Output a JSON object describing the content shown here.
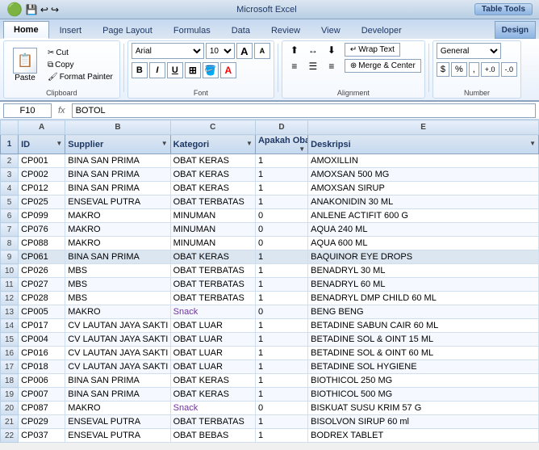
{
  "titleBar": {
    "appName": "Microsoft Excel",
    "fileName": "Table Tools",
    "badge": "Table Tools"
  },
  "tabs": [
    {
      "label": "Home",
      "active": true
    },
    {
      "label": "Insert",
      "active": false
    },
    {
      "label": "Page Layout",
      "active": false
    },
    {
      "label": "Formulas",
      "active": false
    },
    {
      "label": "Data",
      "active": false
    },
    {
      "label": "Review",
      "active": false
    },
    {
      "label": "View",
      "active": false
    },
    {
      "label": "Developer",
      "active": false
    },
    {
      "label": "Design",
      "active": false,
      "special": true
    }
  ],
  "ribbon": {
    "groups": {
      "clipboard": "Clipboard",
      "font": "Font",
      "alignment": "Alignment",
      "number": "Number"
    },
    "paste": "Paste",
    "cut": "Cut",
    "copy": "Copy",
    "formatPainter": "Format Painter",
    "fontName": "Arial",
    "fontSize": "10",
    "bold": "B",
    "italic": "I",
    "underline": "U",
    "wrapText": "Wrap Text",
    "mergeCenter": "Merge & Center",
    "numberFormat": "General"
  },
  "formulaBar": {
    "cellRef": "F10",
    "fx": "fx",
    "value": "BOTOL"
  },
  "columns": [
    {
      "header": "",
      "class": "col-a"
    },
    {
      "header": "ID",
      "class": "col-b"
    },
    {
      "header": "Supplier",
      "class": "col-c"
    },
    {
      "header": "Kategori",
      "class": "col-d"
    },
    {
      "header": "Apakah Obat",
      "class": "col-e"
    },
    {
      "header": "Deskripsi",
      "class": "col-f"
    }
  ],
  "columnLetters": [
    "",
    "A",
    "B",
    "C",
    "D",
    "E"
  ],
  "rows": [
    {
      "num": "2",
      "id": "CP001",
      "supplier": "BINA SAN PRIMA",
      "kategori": "OBAT KERAS",
      "obat": "1",
      "deskripsi": "AMOXILLIN",
      "snack": false,
      "selected": false
    },
    {
      "num": "3",
      "id": "CP002",
      "supplier": "BINA SAN PRIMA",
      "kategori": "OBAT KERAS",
      "obat": "1",
      "deskripsi": "AMOXSAN 500 MG",
      "snack": false,
      "selected": false
    },
    {
      "num": "4",
      "id": "CP012",
      "supplier": "BINA SAN PRIMA",
      "kategori": "OBAT KERAS",
      "obat": "1",
      "deskripsi": "AMOXSAN SIRUP",
      "snack": false,
      "selected": false
    },
    {
      "num": "5",
      "id": "CP025",
      "supplier": "ENSEVAL PUTRA",
      "kategori": "OBAT TERBATAS",
      "obat": "1",
      "deskripsi": "ANAKONIDIN 30 ML",
      "snack": false,
      "selected": false
    },
    {
      "num": "6",
      "id": "CP099",
      "supplier": "MAKRO",
      "kategori": "MINUMAN",
      "obat": "0",
      "deskripsi": "ANLENE ACTIFIT 600 G",
      "snack": false,
      "selected": false
    },
    {
      "num": "7",
      "id": "CP076",
      "supplier": "MAKRO",
      "kategori": "MINUMAN",
      "obat": "0",
      "deskripsi": "AQUA 240 ML",
      "snack": false,
      "selected": false
    },
    {
      "num": "8",
      "id": "CP088",
      "supplier": "MAKRO",
      "kategori": "MINUMAN",
      "obat": "0",
      "deskripsi": "AQUA 600 ML",
      "snack": false,
      "selected": false
    },
    {
      "num": "9",
      "id": "CP061",
      "supplier": "BINA SAN PRIMA",
      "kategori": "OBAT KERAS",
      "obat": "1",
      "deskripsi": "BAQUINOR EYE DROPS",
      "snack": false,
      "selected": true
    },
    {
      "num": "10",
      "id": "CP026",
      "supplier": "MBS",
      "kategori": "OBAT TERBATAS",
      "obat": "1",
      "deskripsi": "BENADRYL 30 ML",
      "snack": false,
      "selected": false
    },
    {
      "num": "11",
      "id": "CP027",
      "supplier": "MBS",
      "kategori": "OBAT TERBATAS",
      "obat": "1",
      "deskripsi": "BENADRYL 60 ML",
      "snack": false,
      "selected": false
    },
    {
      "num": "12",
      "id": "CP028",
      "supplier": "MBS",
      "kategori": "OBAT TERBATAS",
      "obat": "1",
      "deskripsi": "BENADRYL DMP CHILD 60 ML",
      "snack": false,
      "selected": false
    },
    {
      "num": "13",
      "id": "CP005",
      "supplier": "MAKRO",
      "kategori": "Snack",
      "obat": "0",
      "deskripsi": "BENG BENG",
      "snack": true,
      "selected": false
    },
    {
      "num": "14",
      "id": "CP017",
      "supplier": "CV LAUTAN JAYA SAKTI",
      "kategori": "OBAT LUAR",
      "obat": "1",
      "deskripsi": "BETADINE SABUN CAIR 60 ML",
      "snack": false,
      "selected": false
    },
    {
      "num": "15",
      "id": "CP004",
      "supplier": "CV LAUTAN JAYA SAKTI",
      "kategori": "OBAT LUAR",
      "obat": "1",
      "deskripsi": "BETADINE SOL & OINT 15 ML",
      "snack": false,
      "selected": false
    },
    {
      "num": "16",
      "id": "CP016",
      "supplier": "CV LAUTAN JAYA SAKTI",
      "kategori": "OBAT LUAR",
      "obat": "1",
      "deskripsi": "BETADINE SOL & OINT 60 ML",
      "snack": false,
      "selected": false
    },
    {
      "num": "17",
      "id": "CP018",
      "supplier": "CV LAUTAN JAYA SAKTI",
      "kategori": "OBAT LUAR",
      "obat": "1",
      "deskripsi": "BETADINE SOL HYGIENE",
      "snack": false,
      "selected": false
    },
    {
      "num": "18",
      "id": "CP006",
      "supplier": "BINA SAN PRIMA",
      "kategori": "OBAT KERAS",
      "obat": "1",
      "deskripsi": "BIOTHICOL 250 MG",
      "snack": false,
      "selected": false
    },
    {
      "num": "19",
      "id": "CP007",
      "supplier": "BINA SAN PRIMA",
      "kategori": "OBAT KERAS",
      "obat": "1",
      "deskripsi": "BIOTHICOL 500 MG",
      "snack": false,
      "selected": false
    },
    {
      "num": "20",
      "id": "CP087",
      "supplier": "MAKRO",
      "kategori": "Snack",
      "obat": "0",
      "deskripsi": "BISKUAT SUSU KRIM 57 G",
      "snack": true,
      "selected": false
    },
    {
      "num": "21",
      "id": "CP029",
      "supplier": "ENSEVAL PUTRA",
      "kategori": "OBAT TERBATAS",
      "obat": "1",
      "deskripsi": "BISOLVON SIRUP 60 ml",
      "snack": false,
      "selected": false
    },
    {
      "num": "22",
      "id": "CP037",
      "supplier": "ENSEVAL PUTRA",
      "kategori": "OBAT BEBAS",
      "obat": "1",
      "deskripsi": "BODREX TABLET",
      "snack": false,
      "selected": false
    }
  ]
}
